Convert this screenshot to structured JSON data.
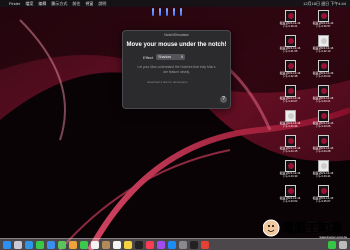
{
  "menubar": {
    "apple_icon": "",
    "items": [
      "Finder",
      "檔案",
      "編輯",
      "顯示方式",
      "前往",
      "視窗",
      "說明"
    ],
    "status": "12月18日 週日 下午4:44"
  },
  "popup": {
    "window_title": "NotchSimulator",
    "heading": "Move your mouse under the notch!",
    "effect_label": "Effect",
    "effect_value": "Shadow",
    "body_text": "Let your Mac understand the Notches that truly Mac's are feature wisely.",
    "link_text": "download a link for developers",
    "help_label": "?"
  },
  "desktop_items": [
    {
      "label1": "截圖 2021-12-16",
      "label2": "下午4.40.21"
    },
    {
      "label1": "截圖 2021-12-16",
      "label2": "下午4.30.57"
    },
    {
      "label1": "截圖 2021-12-16",
      "label2": "下午4.41.55"
    },
    {
      "label1": "截圖 2021-12-16",
      "label2": "下午4.42.13"
    },
    {
      "label1": "截圖 2021-12-16",
      "label2": "下午4.42.38"
    },
    {
      "label1": "截圖 2021-12-16",
      "label2": "下午4.43.02"
    },
    {
      "label1": "截圖 2021-12-16",
      "label2": "下午4.43.07"
    },
    {
      "label1": "截圖 2021-12-16",
      "label2": "下午4.43.21"
    },
    {
      "label1": "截圖 2021-12-16",
      "label2": "下午4.43.44"
    },
    {
      "label1": "截圖 2021-12-16",
      "label2": "下午4.44.06"
    },
    {
      "label1": "截圖 2021-12-16",
      "label2": "下午4.44.15"
    },
    {
      "label1": "截圖 2021-12-16",
      "label2": "下午4.44.28"
    },
    {
      "label1": "截圖 2021-12-16",
      "label2": "下午4.44.33"
    },
    {
      "label1": "截圖 2021-12-16",
      "label2": "下午4.44.41"
    },
    {
      "label1": "截圖 2021-12-16",
      "label2": "下午4.44.52"
    },
    {
      "label1": "截圖 2021-12-16",
      "label2": "下午4.45.07"
    }
  ],
  "dock": {
    "icons": [
      "finder-icon",
      "launchpad-icon",
      "safari-icon",
      "messages-icon",
      "mail-icon",
      "maps-icon",
      "photos-icon",
      "facetime-icon",
      "calendar-icon",
      "contacts-icon",
      "reminders-icon",
      "notes-icon",
      "appletv-icon",
      "music-icon",
      "podcasts-icon",
      "appstore-icon",
      "settings-icon",
      "terminal-icon",
      "chrome-icon",
      "line-icon",
      "trash-icon"
    ],
    "colors": [
      "#2d8ff0",
      "#c9c9d6",
      "#2f95e8",
      "#38c94a",
      "#3a8ef2",
      "#5bc35b",
      "#f0a33a",
      "#3bc84c",
      "#f2f2f2",
      "#b48a5a",
      "#f4f4f4",
      "#f6d23e",
      "#222222",
      "#fa3d55",
      "#a34df0",
      "#1b8cf5",
      "#8a8a8e",
      "#222222",
      "#e44134",
      "#37c546",
      "#bcbcbc"
    ]
  },
  "watermark": {
    "text": "電腦王阿達",
    "url": "www.kocpc.com.tw"
  }
}
